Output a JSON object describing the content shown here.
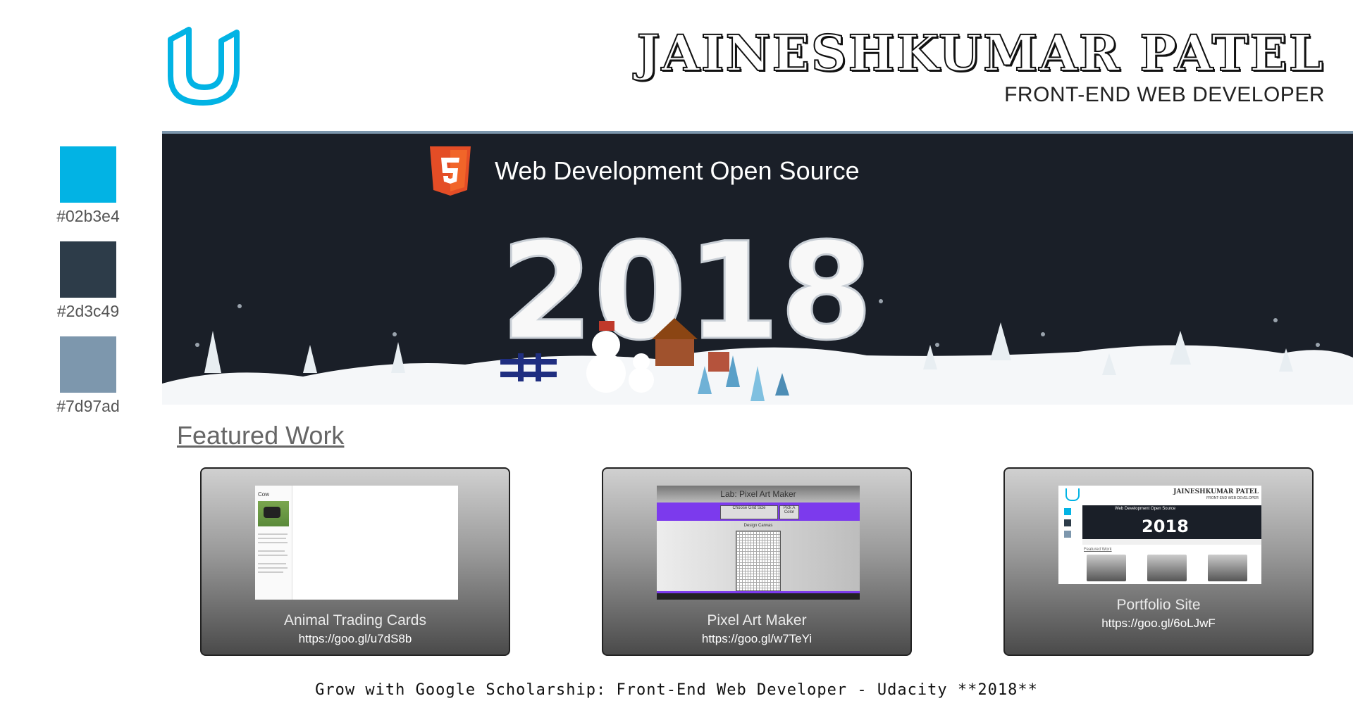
{
  "header": {
    "name": "JAINESHKUMAR PATEL",
    "role": "FRONT-END WEB DEVELOPER",
    "logo_icon": "udacity-logo-icon"
  },
  "palette": [
    {
      "hex": "#02b3e4",
      "label": "#02b3e4"
    },
    {
      "hex": "#2d3c49",
      "label": "#2d3c49"
    },
    {
      "hex": "#7d97ad",
      "label": "#7d97ad"
    }
  ],
  "banner": {
    "title": "Web Development Open Source",
    "year": "2018",
    "icon": "html5-icon"
  },
  "featured": {
    "heading": "Featured Work",
    "projects": [
      {
        "title": "Animal Trading Cards",
        "link": "https://goo.gl/u7dS8b"
      },
      {
        "title": "Pixel Art Maker",
        "link": "https://goo.gl/w7TeYi"
      },
      {
        "title": "Portfolio Site",
        "link": "https://goo.gl/6oLJwF"
      }
    ]
  },
  "footer": {
    "text": "Grow with Google Scholarship: Front-End Web Developer - Udacity **2018**"
  },
  "thumbs": {
    "cow_title": "Cow",
    "pixel_title": "Lab: Pixel Art Maker",
    "pixel_btn1": "Choose Grid Size",
    "pixel_btn2": "Pick A Color",
    "pixel_sub": "Design Canvas",
    "portfolio_name": "JAINESHKUMAR PATEL",
    "portfolio_role": "FRONT-END WEB DEVELOPER",
    "portfolio_banner": "Web Development Open Source",
    "portfolio_year": "2018",
    "portfolio_featured": "Featured Work"
  },
  "colors": {
    "accent": "#02b3e4",
    "dark": "#2d3c49",
    "slate": "#7d97ad",
    "html5": "#e44d26"
  }
}
